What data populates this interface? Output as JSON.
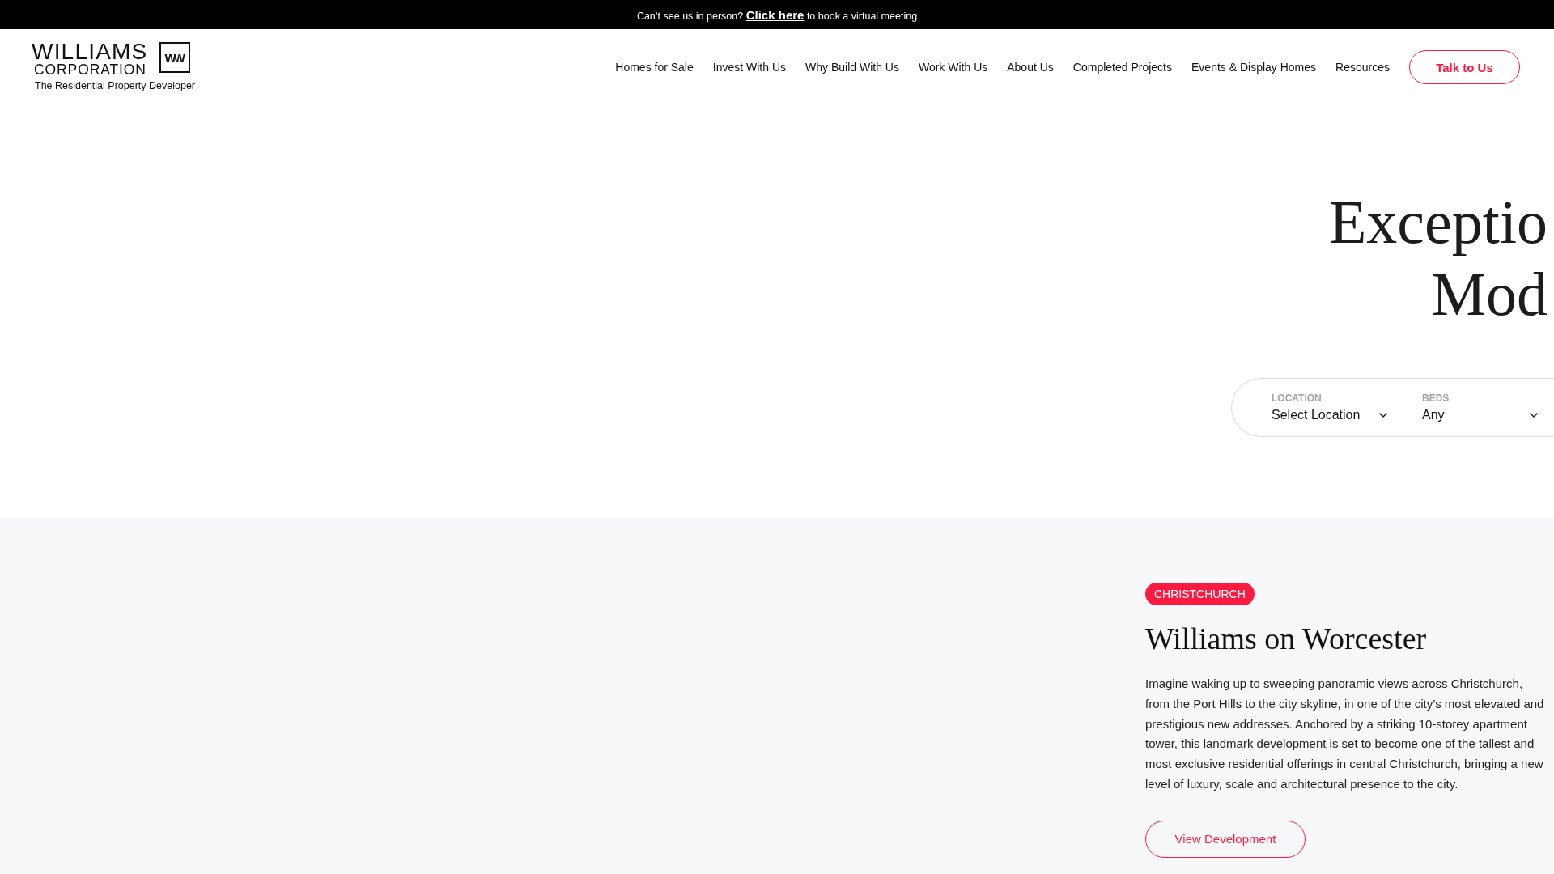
{
  "announcement": {
    "text_before": "Can’t see us in person?",
    "link": "Click here",
    "text_after": "to book a virtual meeting"
  },
  "logo": {
    "name_line_1": "WILLIAMS",
    "name_line_2": "CORPORATION",
    "monogram": "WW",
    "tagline": "The Residential Property Developer"
  },
  "nav": {
    "items": [
      "Homes for Sale",
      "Invest With Us",
      "Why Build With Us",
      "Work With Us",
      "About Us",
      "Completed Projects",
      "Events & Display Homes",
      "Resources"
    ],
    "cta": "Talk to Us"
  },
  "hero": {
    "title_lines": [
      "Exceptio",
      "Mod"
    ],
    "search_fields": [
      {
        "label": "LOCATION",
        "value": "Select Location"
      },
      {
        "label": "BEDS",
        "value": "Any"
      }
    ]
  },
  "feature": {
    "tag": "CHRISTCHURCH",
    "title": "Williams on Worcester",
    "description": "Imagine waking up to sweeping panoramic views across Christchurch, from the Port Hills to the city skyline, in one of the city’s most elevated and prestigious new addresses. Anchored by a striking 10-storey apartment tower, this landmark development is set to become one of the tallest and most exclusive residential offerings in central Christchurch, bringing a new level of luxury, scale and architectural presence to the city.",
    "button": "View Development"
  }
}
